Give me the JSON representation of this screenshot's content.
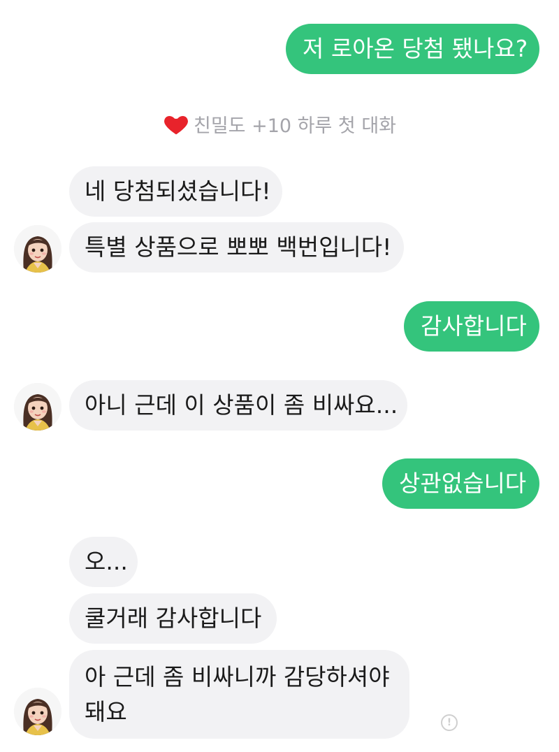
{
  "messages": {
    "m1": "저 로아온 당첨 됐나요?",
    "m2": "네 당첨되셨습니다!",
    "m3": "특별 상품으로 뽀뽀 백번입니다!",
    "m4": "감사합니다",
    "m5": "아니 근데 이 상품이 좀 비싸요...",
    "m6": "상관없습니다",
    "m7": "오...",
    "m8": "쿨거래 감사합니다",
    "m9": "아 근데 좀 비싸니까 감당하셔야 돼요"
  },
  "notice": {
    "text": "친밀도 +10 하루 첫 대화",
    "icon": "heart-icon"
  },
  "colors": {
    "user_bubble": "#34c47c",
    "bot_bubble": "#f2f2f4",
    "notice_text": "#a4a4aa"
  },
  "info_icon": "!"
}
